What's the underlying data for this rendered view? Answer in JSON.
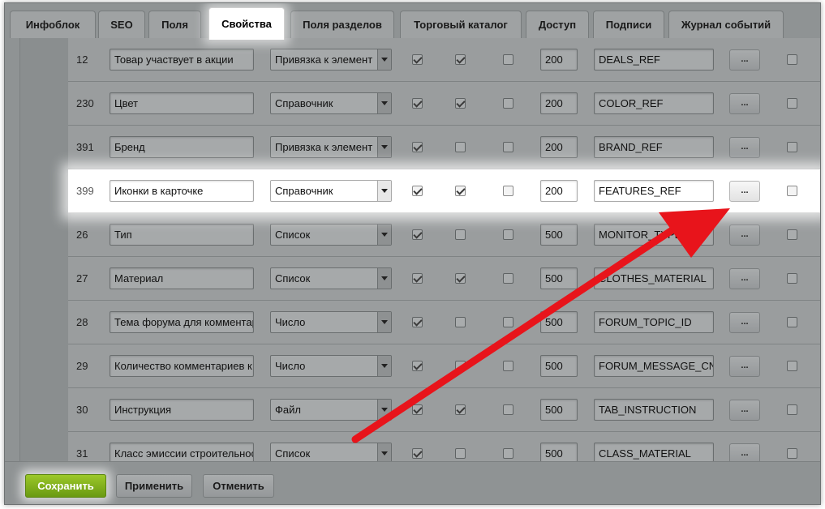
{
  "tabs": [
    {
      "label": "Инфоблок",
      "active": false
    },
    {
      "label": "SEO",
      "active": false
    },
    {
      "label": "Поля",
      "active": false
    },
    {
      "label": "Свойства",
      "active": true
    },
    {
      "label": "Поля разделов",
      "active": false
    },
    {
      "label": "Торговый каталог",
      "active": false
    },
    {
      "label": "Доступ",
      "active": false
    },
    {
      "label": "Подписи",
      "active": false
    },
    {
      "label": "Журнал событий",
      "active": false
    }
  ],
  "properties": [
    {
      "id": "12",
      "name": "Товар участвует в акции",
      "type": "Привязка к элемент",
      "active": true,
      "multiple": true,
      "required": false,
      "sort": "200",
      "code": "DEALS_REF",
      "more": "...",
      "delete": false,
      "highlighted": false
    },
    {
      "id": "230",
      "name": "Цвет",
      "type": "Справочник",
      "active": true,
      "multiple": true,
      "required": false,
      "sort": "200",
      "code": "COLOR_REF",
      "more": "...",
      "delete": false,
      "highlighted": false
    },
    {
      "id": "391",
      "name": "Бренд",
      "type": "Привязка к элемент",
      "active": true,
      "multiple": false,
      "required": false,
      "sort": "200",
      "code": "BRAND_REF",
      "more": "...",
      "delete": false,
      "highlighted": false
    },
    {
      "id": "399",
      "name": "Иконки в карточке",
      "type": "Справочник",
      "active": true,
      "multiple": true,
      "required": false,
      "sort": "200",
      "code": "FEATURES_REF",
      "more": "...",
      "delete": false,
      "highlighted": true
    },
    {
      "id": "26",
      "name": "Тип",
      "type": "Список",
      "active": true,
      "multiple": false,
      "required": false,
      "sort": "500",
      "code": "MONITOR_TYPE",
      "more": "...",
      "delete": false,
      "highlighted": false
    },
    {
      "id": "27",
      "name": "Материал",
      "type": "Список",
      "active": true,
      "multiple": true,
      "required": false,
      "sort": "500",
      "code": "CLOTHES_MATERIAL",
      "more": "...",
      "delete": false,
      "highlighted": false
    },
    {
      "id": "28",
      "name": "Тема форума для комментар",
      "type": "Число",
      "active": true,
      "multiple": false,
      "required": false,
      "sort": "500",
      "code": "FORUM_TOPIC_ID",
      "more": "...",
      "delete": false,
      "highlighted": false
    },
    {
      "id": "29",
      "name": "Количество комментариев к",
      "type": "Число",
      "active": true,
      "multiple": false,
      "required": false,
      "sort": "500",
      "code": "FORUM_MESSAGE_CNT",
      "more": "...",
      "delete": false,
      "highlighted": false
    },
    {
      "id": "30",
      "name": "Инструкция",
      "type": "Файл",
      "active": true,
      "multiple": true,
      "required": false,
      "sort": "500",
      "code": "TAB_INSTRUCTION",
      "more": "...",
      "delete": false,
      "highlighted": false
    },
    {
      "id": "31",
      "name": "Класс эмиссии строительнос",
      "type": "Список",
      "active": true,
      "multiple": false,
      "required": false,
      "sort": "500",
      "code": "CLASS_MATERIAL",
      "more": "...",
      "delete": false,
      "highlighted": false
    }
  ],
  "footer": {
    "save_label": "Сохранить",
    "apply_label": "Применить",
    "cancel_label": "Отменить"
  },
  "colors": {
    "annotation_arrow": "#e8141b",
    "save_button": "#7fb01a",
    "dimmed_overlay": "#8f9394"
  },
  "icons": {
    "checkbox_checked": "check-icon",
    "select_toggle": "chevron-down-icon",
    "annotation": "red-arrow-icon"
  }
}
